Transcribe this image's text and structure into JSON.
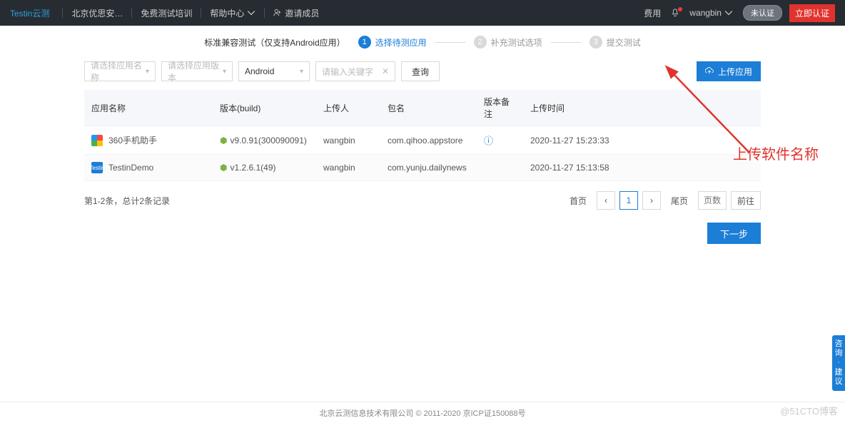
{
  "topnav": {
    "brand": "Testin云测",
    "org": "北京优思安…",
    "free_training": "免费测试培训",
    "help_center": "帮助中心",
    "invite": "邀请成员",
    "cost": "费用",
    "user": "wangbin",
    "uncertified": "未认证",
    "certify_now": "立即认证"
  },
  "steps": {
    "title": "标准兼容测试（仅支持Android应用）",
    "s1": "选择待测应用",
    "s2": "补充测试选项",
    "s3": "提交测试"
  },
  "filters": {
    "select_name_ph": "请选择应用名称",
    "select_version_ph": "请选择应用版本",
    "platform": "Android",
    "search_ph": "请输入关键字",
    "query": "查询",
    "upload": "上传应用"
  },
  "table": {
    "headers": {
      "name": "应用名称",
      "version": "版本(build)",
      "uploader": "上传人",
      "package": "包名",
      "remark": "版本备注",
      "time": "上传时间"
    },
    "rows": [
      {
        "icon": "multi",
        "icon_label": "",
        "name": "360手机助手",
        "version": "v9.0.91(300090091)",
        "uploader": "wangbin",
        "package": "com.qihoo.appstore",
        "remark_icon": true,
        "time": "2020-11-27 15:23:33"
      },
      {
        "icon": "blue",
        "icon_label": "Testin",
        "name": "TestinDemo",
        "version": "v1.2.6.1(49)",
        "uploader": "wangbin",
        "package": "com.yunju.dailynews",
        "remark_icon": false,
        "time": "2020-11-27 15:13:58"
      }
    ]
  },
  "pagination": {
    "info": "第1-2条，总计2条记录",
    "first": "首页",
    "current": "1",
    "last": "尾页",
    "page_label": "页数",
    "go": "前往"
  },
  "next": "下一步",
  "annotation": "上传软件名称",
  "footer": "北京云测信息技术有限公司 © 2011-2020 京ICP证150088号",
  "side_tab": "咨询 · 建议",
  "watermark": "@51CTO博客"
}
